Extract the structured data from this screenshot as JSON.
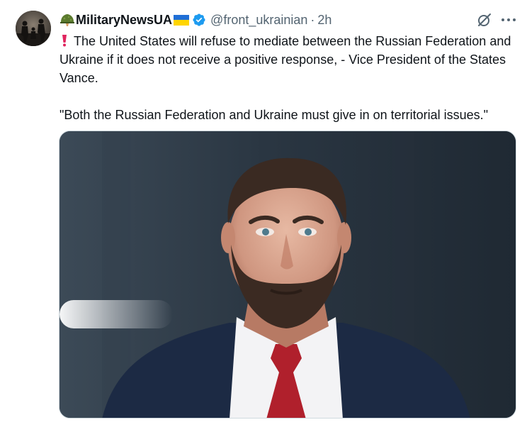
{
  "author": {
    "display_name": "MilitaryNewsUA",
    "handle": "@front_ukrainian",
    "separator": "·",
    "time": "2h",
    "avatar_icon": "soldiers-silhouette-avatar",
    "name_prefix_icon": "military-helmet-emoji",
    "name_suffix_icon": "ukraine-flag-emoji",
    "verified_icon": "verified-badge-icon",
    "verified_color": "#1d9bf0"
  },
  "actions": {
    "grok_icon": "grok-icon",
    "more_icon": "more-dots-icon"
  },
  "body": {
    "paragraph_1": "The United States will refuse to mediate between the Russian Federation and Ukraine if it does not receive a positive response, - Vice President of the States Vance.",
    "paragraph_2": "\"Both the Russian Federation and Ukraine must give in on territorial issues.\"",
    "exclamation_icon": "red-exclamation-icon"
  },
  "media": {
    "type": "photo",
    "description_icon": "man-portrait-photo"
  },
  "colors": {
    "text": "#0f1419",
    "secondary": "#536471",
    "accent": "#1d9bf0"
  }
}
